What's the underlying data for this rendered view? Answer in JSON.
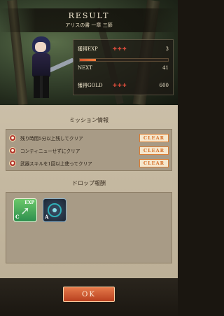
{
  "result": {
    "title": "RESULT",
    "subtitle": "アリスの書 一章 三節"
  },
  "stats": {
    "exp_label": "獲得EXP",
    "exp_stars": "✚✚✚",
    "exp_value": "3",
    "exp_progress": 0.18,
    "next_label": "NEXT",
    "next_value": "41",
    "gold_label": "獲得GOLD",
    "gold_stars": "✚✚✚",
    "gold_value": "600"
  },
  "missions": {
    "header": "ミッション情報",
    "items": [
      {
        "text": "残り時間5分以上残してクリア",
        "status": "CLEAR"
      },
      {
        "text": "コンティニューせずにクリア",
        "status": "CLEAR"
      },
      {
        "text": "武器スキルを1回以上使ってクリア",
        "status": "CLEAR"
      }
    ]
  },
  "drops": {
    "header": "ドロップ報酬",
    "items": [
      {
        "label": "EXP",
        "grade": "C"
      },
      {
        "grade": "A"
      }
    ]
  },
  "footer": {
    "ok_label": "OK"
  },
  "colors": {
    "clear_badge": "#d56e26",
    "ok_button": "#c8532a"
  }
}
